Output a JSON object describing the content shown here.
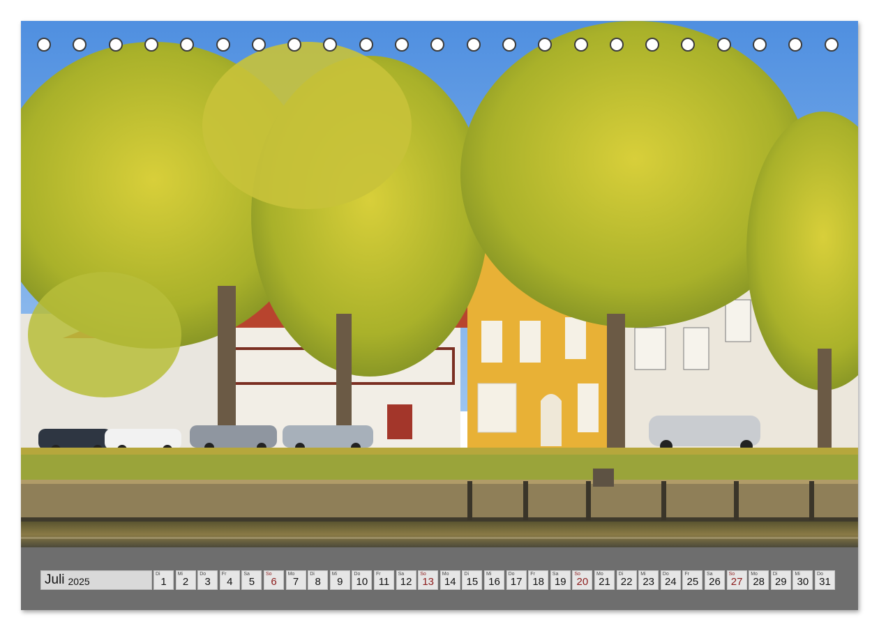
{
  "calendar": {
    "month": "Juli",
    "year": "2025",
    "days": [
      {
        "wd": "Di",
        "d": "1",
        "sun": false
      },
      {
        "wd": "Mi",
        "d": "2",
        "sun": false
      },
      {
        "wd": "Do",
        "d": "3",
        "sun": false
      },
      {
        "wd": "Fr",
        "d": "4",
        "sun": false
      },
      {
        "wd": "Sa",
        "d": "5",
        "sun": false
      },
      {
        "wd": "So",
        "d": "6",
        "sun": true
      },
      {
        "wd": "Mo",
        "d": "7",
        "sun": false
      },
      {
        "wd": "Di",
        "d": "8",
        "sun": false
      },
      {
        "wd": "Mi",
        "d": "9",
        "sun": false
      },
      {
        "wd": "Do",
        "d": "10",
        "sun": false
      },
      {
        "wd": "Fr",
        "d": "11",
        "sun": false
      },
      {
        "wd": "Sa",
        "d": "12",
        "sun": false
      },
      {
        "wd": "So",
        "d": "13",
        "sun": true
      },
      {
        "wd": "Mo",
        "d": "14",
        "sun": false
      },
      {
        "wd": "Di",
        "d": "15",
        "sun": false
      },
      {
        "wd": "Mi",
        "d": "16",
        "sun": false
      },
      {
        "wd": "Do",
        "d": "17",
        "sun": false
      },
      {
        "wd": "Fr",
        "d": "18",
        "sun": false
      },
      {
        "wd": "Sa",
        "d": "19",
        "sun": false
      },
      {
        "wd": "So",
        "d": "20",
        "sun": true
      },
      {
        "wd": "Mo",
        "d": "21",
        "sun": false
      },
      {
        "wd": "Di",
        "d": "22",
        "sun": false
      },
      {
        "wd": "Mi",
        "d": "23",
        "sun": false
      },
      {
        "wd": "Do",
        "d": "24",
        "sun": false
      },
      {
        "wd": "Fr",
        "d": "25",
        "sun": false
      },
      {
        "wd": "Sa",
        "d": "26",
        "sun": false
      },
      {
        "wd": "So",
        "d": "27",
        "sun": true
      },
      {
        "wd": "Mo",
        "d": "28",
        "sun": false
      },
      {
        "wd": "Di",
        "d": "29",
        "sun": false
      },
      {
        "wd": "Mi",
        "d": "30",
        "sun": false
      },
      {
        "wd": "Do",
        "d": "31",
        "sun": false
      }
    ]
  },
  "colors": {
    "strip": "#6e6e6e",
    "sunday": "#8b1a1a"
  }
}
